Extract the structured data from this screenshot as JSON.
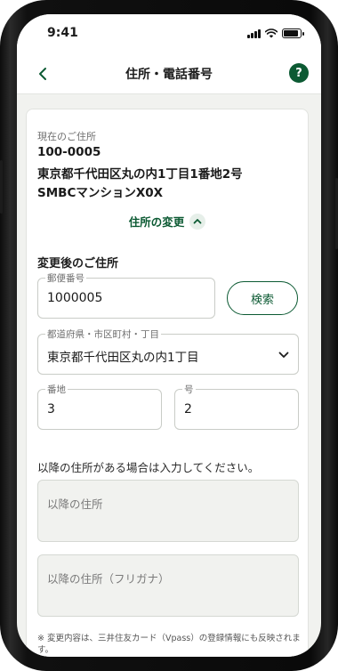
{
  "status_bar": {
    "time": "9:41",
    "battery_level": 0.9
  },
  "nav": {
    "back_icon": "chevron-left-icon",
    "title": "住所・電話番号",
    "help_label": "?"
  },
  "current_address": {
    "label": "現在のご住所",
    "postal_code": "100-0005",
    "address_line": "東京都千代田区丸の内1丁目1番地2号",
    "building": "SMBCマンションX0X"
  },
  "change_toggle": {
    "label": "住所の変更",
    "icon": "chevron-up-icon"
  },
  "new_address": {
    "title": "変更後のご住所",
    "postal_code": {
      "label": "郵便番号",
      "value": "1000005"
    },
    "search_button": "検索",
    "region": {
      "label": "都道府県・市区町村・丁目",
      "value": "東京都千代田区丸の内1丁目"
    },
    "banchi": {
      "label": "番地",
      "value": "3"
    },
    "go": {
      "label": "号",
      "value": "2"
    },
    "hint": "以降の住所がある場合は入力してください。",
    "rest_address": {
      "placeholder": "以降の住所"
    },
    "rest_address_kana": {
      "placeholder": "以降の住所（フリガナ）"
    }
  },
  "note": "※ 変更内容は、三井住友カード（Vpass）の登録情報にも反映されます。",
  "colors": {
    "brand_green": "#0c5a33",
    "background": "#f1f2ef"
  }
}
